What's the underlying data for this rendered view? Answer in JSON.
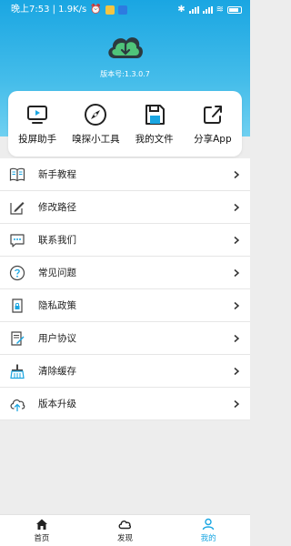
{
  "status_bar": {
    "time_text": "晚上7:53 | 1.9K/s",
    "battery": "battery-icon"
  },
  "app": {
    "version": "版本号:1.3.0.7",
    "accent": "#1aa6e2"
  },
  "quick_actions": [
    {
      "label": "投屏助手",
      "icon": "screen-cast-icon"
    },
    {
      "label": "嗅探小工具",
      "icon": "compass-icon"
    },
    {
      "label": "我的文件",
      "icon": "save-file-icon"
    },
    {
      "label": "分享App",
      "icon": "share-icon"
    }
  ],
  "menu": [
    {
      "label": "新手教程",
      "icon": "book-icon"
    },
    {
      "label": "修改路径",
      "icon": "edit-icon"
    },
    {
      "label": "联系我们",
      "icon": "chat-icon"
    },
    {
      "label": "常见问题",
      "icon": "question-icon"
    },
    {
      "label": "隐私政策",
      "icon": "privacy-icon"
    },
    {
      "label": "用户协议",
      "icon": "agreement-icon"
    },
    {
      "label": "清除缓存",
      "icon": "broom-icon"
    },
    {
      "label": "版本升级",
      "icon": "cloud-upload-icon"
    }
  ],
  "tabs": [
    {
      "label": "首页",
      "icon": "home-icon"
    },
    {
      "label": "发现",
      "icon": "cloud-icon"
    },
    {
      "label": "我的",
      "icon": "user-icon"
    }
  ]
}
